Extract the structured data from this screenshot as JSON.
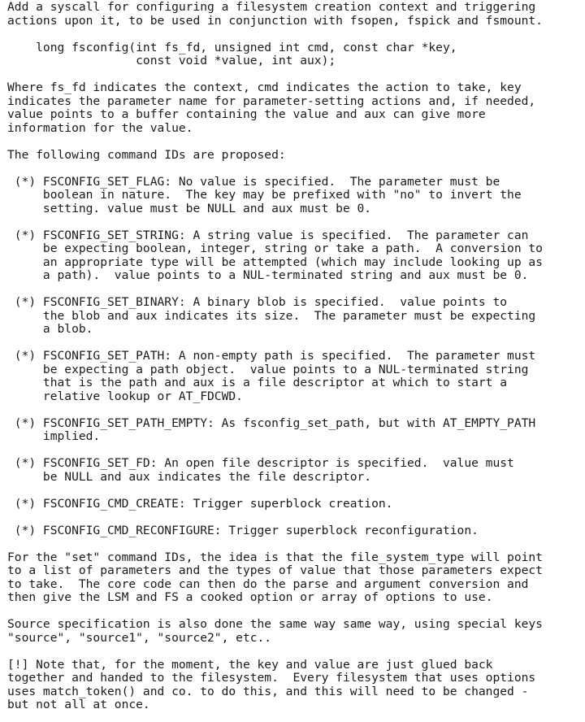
{
  "document": {
    "lines": [
      "Add a syscall for configuring a filesystem creation context and triggering",
      "actions upon it, to be used in conjunction with fsopen, fspick and fsmount.",
      "",
      "    long fsconfig(int fs_fd, unsigned int cmd, const char *key,",
      "                  const void *value, int aux);",
      "",
      "Where fs_fd indicates the context, cmd indicates the action to take, key",
      "indicates the parameter name for parameter-setting actions and, if needed,",
      "value points to a buffer containing the value and aux can give more",
      "information for the value.",
      "",
      "The following command IDs are proposed:",
      "",
      " (*) FSCONFIG_SET_FLAG: No value is specified.  The parameter must be",
      "     boolean in nature.  The key may be prefixed with \"no\" to invert the",
      "     setting. value must be NULL and aux must be 0.",
      "",
      " (*) FSCONFIG_SET_STRING: A string value is specified.  The parameter can",
      "     be expecting boolean, integer, string or take a path.  A conversion to",
      "     an appropriate type will be attempted (which may include looking up as",
      "     a path).  value points to a NUL-terminated string and aux must be 0.",
      "",
      " (*) FSCONFIG_SET_BINARY: A binary blob is specified.  value points to",
      "     the blob and aux indicates its size.  The parameter must be expecting",
      "     a blob.",
      "",
      " (*) FSCONFIG_SET_PATH: A non-empty path is specified.  The parameter must",
      "     be expecting a path object.  value points to a NUL-terminated string",
      "     that is the path and aux is a file descriptor at which to start a",
      "     relative lookup or AT_FDCWD.",
      "",
      " (*) FSCONFIG_SET_PATH_EMPTY: As fsconfig_set_path, but with AT_EMPTY_PATH",
      "     implied.",
      "",
      " (*) FSCONFIG_SET_FD: An open file descriptor is specified.  value must",
      "     be NULL and aux indicates the file descriptor.",
      "",
      " (*) FSCONFIG_CMD_CREATE: Trigger superblock creation.",
      "",
      " (*) FSCONFIG_CMD_RECONFIGURE: Trigger superblock reconfiguration.",
      "",
      "For the \"set\" command IDs, the idea is that the file_system_type will point",
      "to a list of parameters and the types of value that those parameters expect",
      "to take.  The core code can then do the parse and argument conversion and",
      "then give the LSM and FS a cooked option or array of options to use.",
      "",
      "Source specification is also done the same way same way, using special keys",
      "\"source\", \"source1\", \"source2\", etc..",
      "",
      "[!] Note that, for the moment, the key and value are just glued back",
      "together and handed to the filesystem.  Every filesystem that uses options",
      "uses match_token() and co. to do this, and this will need to be changed -",
      "but not all at once."
    ]
  }
}
